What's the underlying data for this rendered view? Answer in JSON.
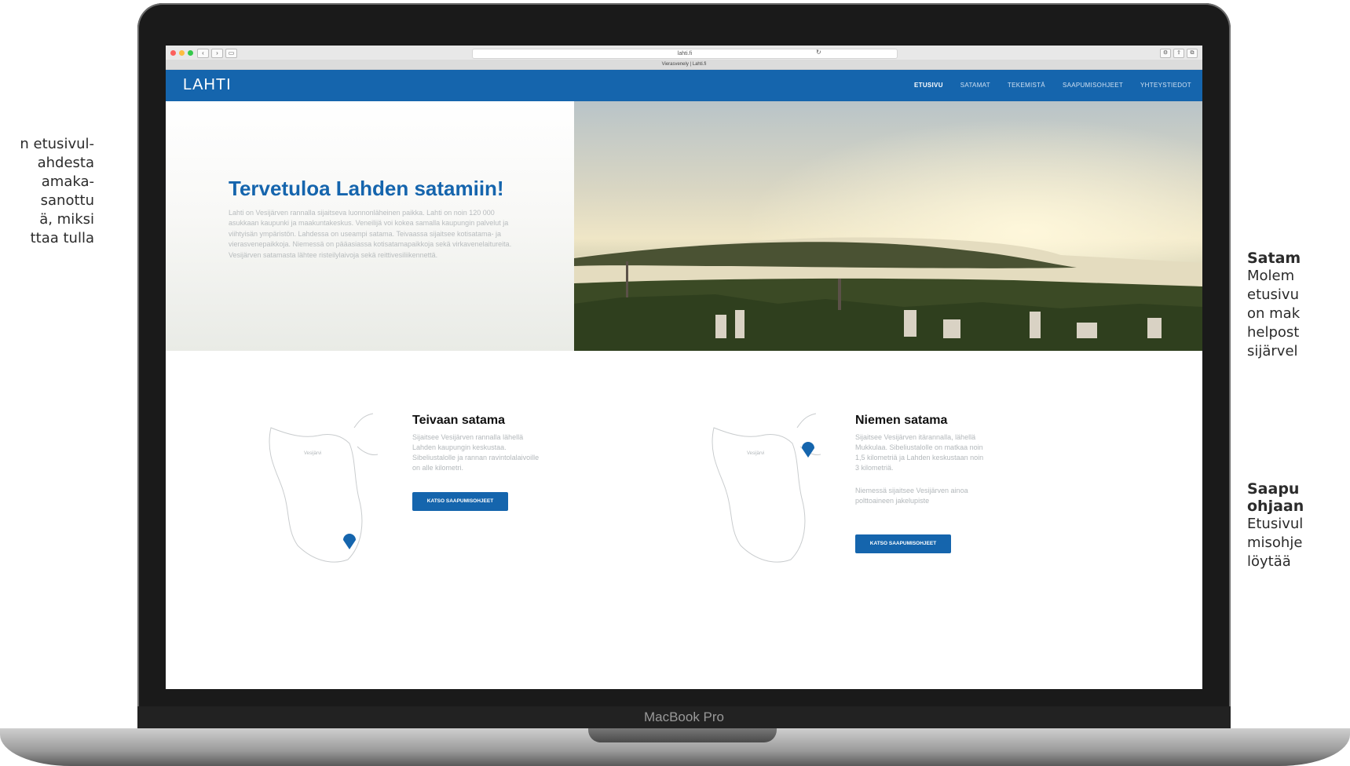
{
  "annotations": {
    "left_text": "n etusivul-\nahdesta\namaka-\n sanottu\nä, miksi\nttaa tulla",
    "right": [
      {
        "heading": "Satam",
        "body": "Molem\netusivu\non mak\nhelpost\nsijärvel"
      },
      {
        "heading": "Saapu\nohjaan",
        "body": "Etusivul\nmisohje\nlöytää"
      }
    ]
  },
  "device": {
    "label": "MacBook Pro"
  },
  "browser": {
    "url": "lahti.fi",
    "tab_title": "Vierasvenely | Lahti.fi",
    "back": "‹",
    "forward": "›",
    "sidebar": "▭",
    "reload": "↻",
    "right_buttons": [
      "⚙",
      "⇪",
      "⧉"
    ]
  },
  "site": {
    "logo": "LAHTI",
    "menu": [
      "ETUSIVU",
      "SATAMAT",
      "TEKEMISTÄ",
      "SAAPUMISOHJEET",
      "YHTEYSTIEDOT"
    ],
    "active_menu": "ETUSIVU"
  },
  "hero": {
    "title": "Tervetuloa Lahden satamiin!",
    "body": "Lahti on Vesijärven rannalla sijaitseva luonnonläheinen paikka. Lahti on noin 120 000 asukkaan kaupunki ja maakuntakeskus. Veneilijä voi kokea samalla kaupungin palvelut ja viihtyisän ympäristön. Lahdessa on useampi satama. Teivaassa sijaitsee kotisatama- ja vierasvenepaikkoja. Niemessä on pääasiassa kotisatamapaikkoja sekä virkavenelaitureita. Vesijärven satamasta lähtee risteilylaivoja sekä reittivesiliikennettä."
  },
  "cards": [
    {
      "title": "Teivaan satama",
      "text": "Sijaitsee Vesijärven rannalla lähellä Lahden kaupungin keskustaa. Sibeliustalolle ja rannan ravintolalaivoille on alle kilometri.",
      "text2": "",
      "map_label": "Vesijärvi",
      "button": "KATSO SAAPUMISOHJEET"
    },
    {
      "title": "Niemen satama",
      "text": "Sijaitsee Vesijärven itärannalla, lähellä Mukkulaa. Sibeliustalolle on matkaa noin 1,5 kilometriä ja Lahden keskustaan noin 3 kilometriä.",
      "text2": "Niemessä sijaitsee Vesijärven ainoa polttoaineen jakelupiste",
      "map_label": "Vesijärvi",
      "button": "KATSO SAAPUMISOHJEET"
    }
  ],
  "colors": {
    "brand_blue": "#1565ad",
    "text_muted": "#b8bcbe"
  }
}
